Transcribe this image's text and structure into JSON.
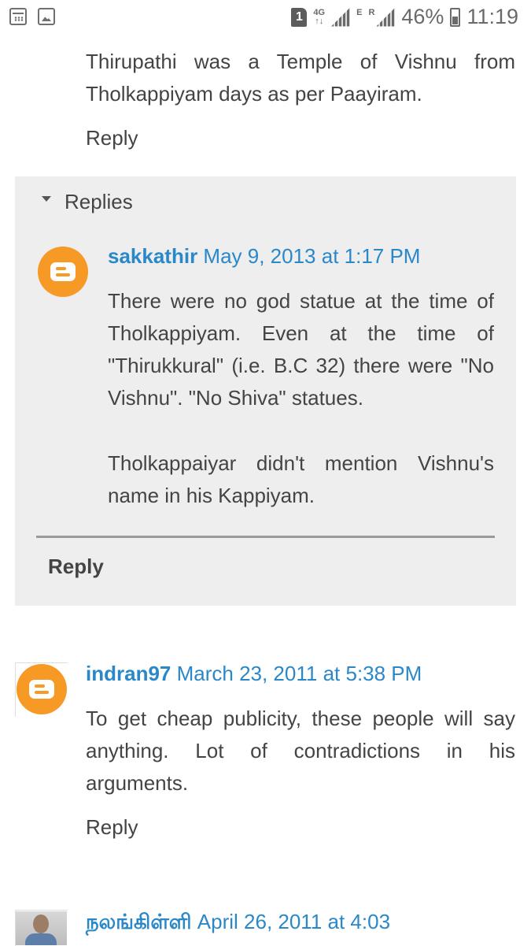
{
  "status_bar": {
    "sim_slot": "1",
    "network_top": "4G",
    "network_bottom": "↑↓",
    "roaming_e": "E",
    "roaming_r": "R",
    "battery": "46%",
    "time": "11:19"
  },
  "comments": [
    {
      "text": "Thirupathi was a Temple of Vishnu from Tholkappiyam days as per Paayiram.",
      "reply_label": "Reply"
    },
    {
      "author": "indran97",
      "date": "March 23, 2011 at 5:38 PM",
      "text": "To get cheap publicity, these people will say anything. Lot of contradictions in his arguments.",
      "reply_label": "Reply"
    },
    {
      "author": "நலங்கிள்ளி",
      "date": "April 26, 2011 at 4:03"
    }
  ],
  "replies_section": {
    "toggle_label": "Replies",
    "reply": {
      "author": "sakkathir",
      "date": "May 9, 2013 at 1:17 PM",
      "paragraph1": "There were no god statue at the time of Tholkappiyam. Even at the time of \"Thirukkural\" (i.e. B.C 32) there were \"No Vishnu\". \"No Shiva\" statues.",
      "paragraph2": "Tholkappaiyar didn't mention Vishnu's name in his Kappiyam."
    },
    "reply_button": "Reply"
  },
  "colors": {
    "link": "#2a88c8",
    "text": "#444444",
    "replies_bg": "#eeeeee",
    "blogger_orange": "#f79a25"
  }
}
